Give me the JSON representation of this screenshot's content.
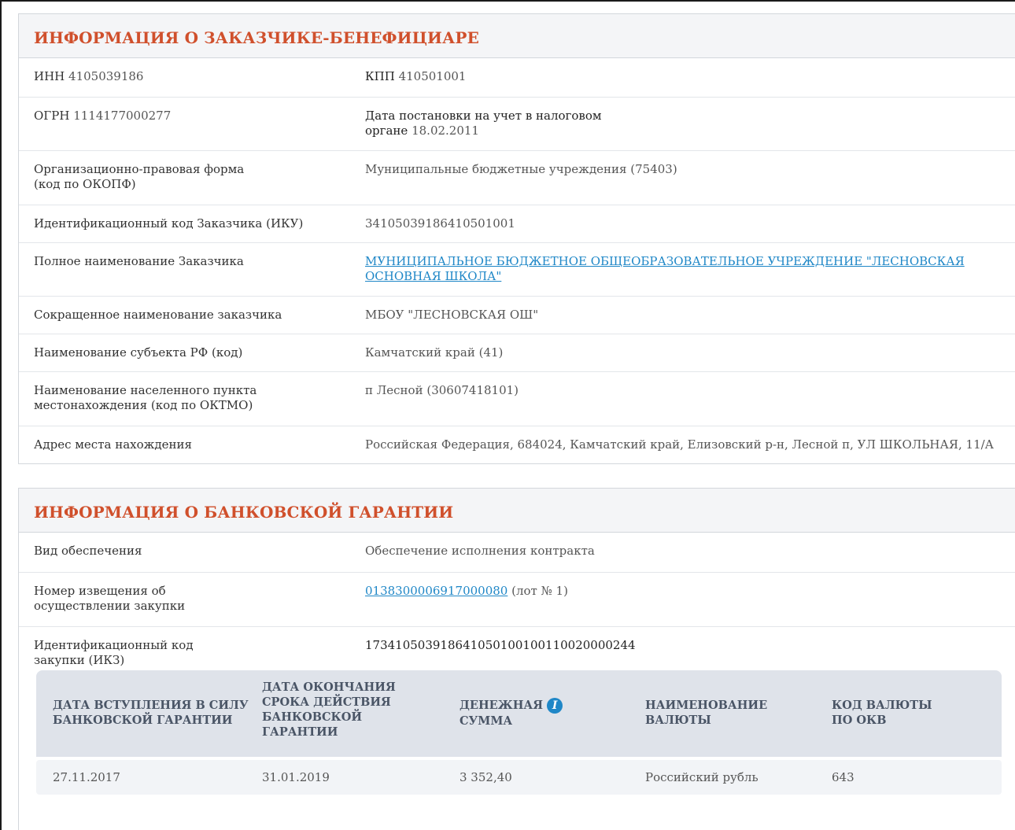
{
  "customer": {
    "title": "ИНФОРМАЦИЯ О ЗАКАЗЧИКЕ-БЕНЕФИЦИАРЕ",
    "inn_label": "ИНН",
    "inn_value": "4105039186",
    "kpp_label": "КПП",
    "kpp_value": "410501001",
    "ogrn_label": "ОГРН",
    "ogrn_value": "1114177000277",
    "tax_reg_label_line1": "Дата постановки на учет в налоговом",
    "tax_reg_label_line2": "органе",
    "tax_reg_value": "18.02.2011",
    "opf_label_line1": "Организационно-правовая форма",
    "opf_label_line2": "(код по ОКОПФ)",
    "opf_value": "Муниципальные бюджетные учреждения (75403)",
    "iku_label": "Идентификационный код Заказчика (ИКУ)",
    "iku_value": "341050391864105010 01",
    "full_name_label": "Полное наименование Заказчика",
    "full_name_line1": "МУНИЦИПАЛЬНОЕ БЮДЖЕТНОЕ ОБЩЕОБРАЗОВАТЕЛЬНОЕ УЧРЕЖДЕНИЕ \"ЛЕСНОВСКАЯ",
    "full_name_line2": "ОСНОВНАЯ ШКОЛА\"",
    "short_name_label": "Сокращенное наименование заказчика",
    "short_name_value": "МБОУ \"ЛЕСНОВСКАЯ ОШ\"",
    "region_label": "Наименование субъекта РФ (код)",
    "region_value": "Камчатский край (41)",
    "locality_label_line1": "Наименование населенного пункта",
    "locality_label_line2": "местонахождения (код по ОКТМО)",
    "locality_value": "п Лесной (30607418101)",
    "address_label": "Адрес места нахождения",
    "address_value": "Российская Федерация, 684024, Камчатский край, Елизовский р-н, Лесной п, УЛ ШКОЛЬНАЯ, 11/А"
  },
  "guarantee": {
    "title": "ИНФОРМАЦИЯ О БАНКОВСКОЙ ГАРАНТИИ",
    "security_type_label": "Вид обеспечения",
    "security_type_value": "Обеспечение исполнения контракта",
    "notice_label_line1": "Номер извещения об",
    "notice_label_line2": "осуществлении закупки",
    "notice_number": "0138300006917000080",
    "notice_lot": "(лот № 1)",
    "ikz_label_line1": "Идентификационный код",
    "ikz_label_line2": "закупки (ИКЗ)",
    "ikz_value": "173410503918641050100100110020000244",
    "table": {
      "headers": [
        [
          "ДАТА ВСТУПЛЕНИЯ В СИЛУ",
          "БАНКОВСКОЙ ГАРАНТИИ"
        ],
        [
          "ДАТА ОКОНЧАНИЯ",
          "СРОКА ДЕЙСТВИЯ",
          "БАНКОВСКОЙ",
          "ГАРАНТИИ"
        ],
        [
          "ДЕНЕЖНАЯ",
          "СУММА"
        ],
        [
          "НАИМЕНОВАНИЕ",
          "ВАЛЮТЫ"
        ],
        [
          "КОД ВАЛЮТЫ",
          "ПО ОКВ"
        ]
      ],
      "row": [
        "27.11.2017",
        "31.01.2019",
        "3 352,40",
        "Российский рубль",
        "643"
      ],
      "info_icon": "info-icon"
    }
  }
}
